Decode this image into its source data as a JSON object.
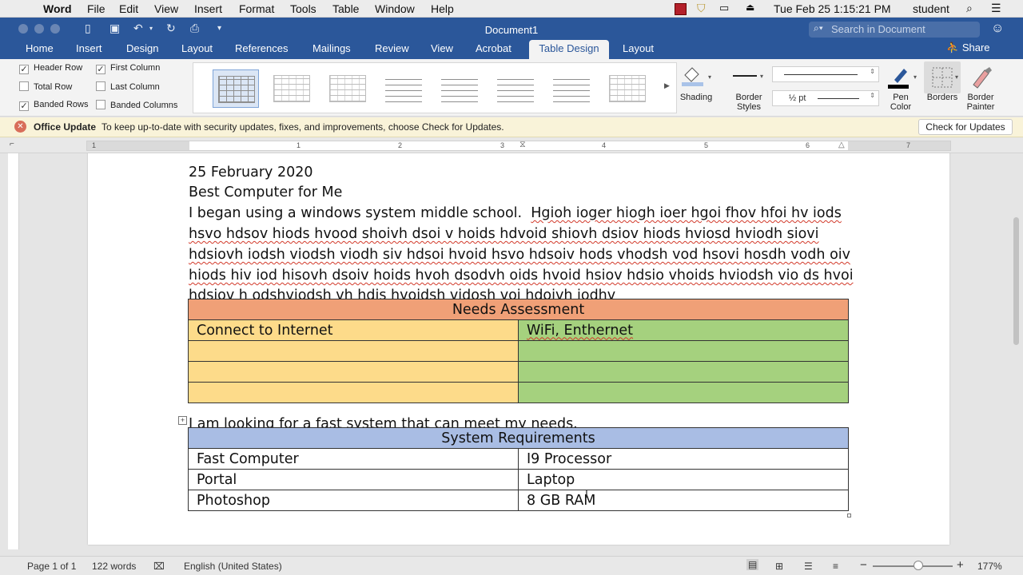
{
  "menubar": {
    "app": "Word",
    "items": [
      "File",
      "Edit",
      "View",
      "Insert",
      "Format",
      "Tools",
      "Table",
      "Window",
      "Help"
    ],
    "datetime": "Tue Feb 25  1:15:21 PM",
    "user": "student"
  },
  "window": {
    "title": "Document1",
    "search_placeholder": "Search in Document",
    "share": "Share"
  },
  "ribbon_tabs": [
    "Home",
    "Insert",
    "Design",
    "Layout",
    "References",
    "Mailings",
    "Review",
    "View",
    "Acrobat",
    "Table Design",
    "Layout"
  ],
  "active_tab": "Table Design",
  "table_style_options": [
    {
      "label": "Header Row",
      "checked": true
    },
    {
      "label": "First Column",
      "checked": true
    },
    {
      "label": "Total Row",
      "checked": false
    },
    {
      "label": "Last Column",
      "checked": false
    },
    {
      "label": "Banded Rows",
      "checked": true
    },
    {
      "label": "Banded Columns",
      "checked": false
    }
  ],
  "ribbon": {
    "shading": "Shading",
    "border_styles": "Border Styles",
    "pen_weight": "½ pt",
    "pen_color": "Pen Color",
    "borders": "Borders",
    "border_painter": "Border Painter"
  },
  "message_bar": {
    "title": "Office Update",
    "text": "To keep up-to-date with security updates, fixes, and improvements, choose Check for Updates.",
    "button": "Check for Updates"
  },
  "ruler_numbers": [
    "1",
    "1",
    "2",
    "3",
    "4",
    "5",
    "6",
    "7"
  ],
  "document": {
    "date": "25 February 2020",
    "heading": "Best Computer for Me",
    "para_first": "I began using a windows system middle school.  ",
    "para_first_squig": "Hgioh ioger hiogh ioer hgoi fhov hfoi hv iods",
    "para_lines": [
      "hsvo hdsov hiods hvood shoivh dsoi v hoids hdvoid shiovh dsiov hiods hviosd hviodh siovi",
      "hdsiovh iodsh viodsh viodh siv hdsoi hvoid hsvo hdsoiv hods vhodsh vod hsovi hosdh vodh oiv",
      "hiods hiv iod hisovh dsoiv hoids hvoh dsodvh oids hvoid hsiov hdsio vhoids hviodsh vio ds hvoi",
      "hdsiov h odshviodsh vh hdis hvoidsh vidosh voi hdoivh iodhv"
    ],
    "needs_table": {
      "title": "Needs Assessment",
      "rows": [
        [
          "Connect to Internet",
          "WiFi, Enthernet"
        ],
        [
          "",
          ""
        ],
        [
          "",
          ""
        ],
        [
          "",
          ""
        ]
      ]
    },
    "mid_sentence": "I am looking for a fast system that can meet my needs.",
    "sys_table": {
      "title": "System Requirements",
      "rows": [
        [
          "Fast Computer",
          "I9 Processor"
        ],
        [
          "Portal",
          "Laptop"
        ],
        [
          "Photoshop",
          "8 GB RAM"
        ]
      ]
    }
  },
  "status": {
    "page": "Page 1 of 1",
    "words": "122 words",
    "language": "English (United States)",
    "zoom": "177%"
  },
  "colors": {
    "titlebar": "#2b579a",
    "needs_header": "#f0a077",
    "needs_left": "#fddb8a",
    "needs_right": "#a5d17e",
    "sys_header": "#a9bde4"
  }
}
